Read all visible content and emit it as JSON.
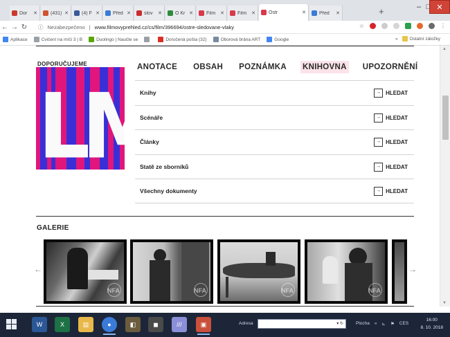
{
  "browser": {
    "tabs": [
      {
        "title": "Dor",
        "fav": "#c93b2b"
      },
      {
        "title": "(431)",
        "fav": "#d0532f"
      },
      {
        "title": "(4) F",
        "fav": "#3b5998"
      },
      {
        "title": "Před",
        "fav": "#3a7bd5"
      },
      {
        "title": "slov",
        "fav": "#c82e2e"
      },
      {
        "title": "O Kr",
        "fav": "#2f8a3b"
      },
      {
        "title": "Film",
        "fav": "#d9394b"
      },
      {
        "title": "Film",
        "fav": "#d9394b"
      },
      {
        "title": "Ostr",
        "fav": "#d9394b",
        "active": true
      },
      {
        "title": "Před",
        "fav": "#3a7bd5"
      }
    ],
    "new_tab": "+",
    "controls": {
      "minimize": "–",
      "maximize": "□",
      "close": "✕"
    },
    "security_label": "Nezabezpečeno",
    "url": "www.filmovyprehled.cz/cs/film/396694/ostre-sledovane-vlaky"
  },
  "bookmarks": {
    "items": [
      {
        "label": "Aplikace",
        "icon": "apps-icon",
        "color": "#4285f4"
      },
      {
        "label": "Cvičení na míči 3 | B",
        "icon": "page-icon",
        "color": "#9aa0a6"
      },
      {
        "label": "Duolingo | Naučte se",
        "icon": "duolingo-icon",
        "color": "#58a700"
      },
      {
        "label": "",
        "icon": "page-icon",
        "color": "#9aa0a6"
      },
      {
        "label": "Doručená pošta (32)",
        "icon": "gmail-icon",
        "color": "#d93025"
      },
      {
        "label": "Oborová brána ART",
        "icon": "link-icon",
        "color": "#7a8aa0"
      },
      {
        "label": "Google",
        "icon": "google-icon",
        "color": "#4285f4"
      }
    ],
    "more": "»",
    "other": "Ostatní záložky"
  },
  "page": {
    "recommend_label": "DOPORUČUJEME",
    "poster_text": "LM",
    "tabs": [
      {
        "label": "ANOTACE",
        "active": false
      },
      {
        "label": "OBSAH",
        "active": false
      },
      {
        "label": "POZNÁMKA",
        "active": false
      },
      {
        "label": "KNIHOVNA",
        "active": true
      },
      {
        "label": "UPOZORNĚNÍ",
        "active": false
      }
    ],
    "rows": [
      {
        "label": "Knihy",
        "action": "HLEDAT"
      },
      {
        "label": "Scénáře",
        "action": "HLEDAT"
      },
      {
        "label": "Články",
        "action": "HLEDAT"
      },
      {
        "label": "Statě ze sborníků",
        "action": "HLEDAT"
      },
      {
        "label": "Všechny dokumenty",
        "action": "HLEDAT"
      }
    ],
    "gallery_title": "GALERIE",
    "watermark": "NFA",
    "prev_arrow": "←",
    "next_arrow": "→"
  },
  "taskbar": {
    "address_label": "Adresa",
    "desktop_label": "Plocha",
    "language": "CES",
    "time": "16:00",
    "date": "8. 10. 2018"
  },
  "colors": {
    "active_tab_bg": "#fbe3ea",
    "poster_pink": "#e0167d",
    "poster_blue": "#3a2fd6",
    "taskbar": "#1c2638"
  }
}
